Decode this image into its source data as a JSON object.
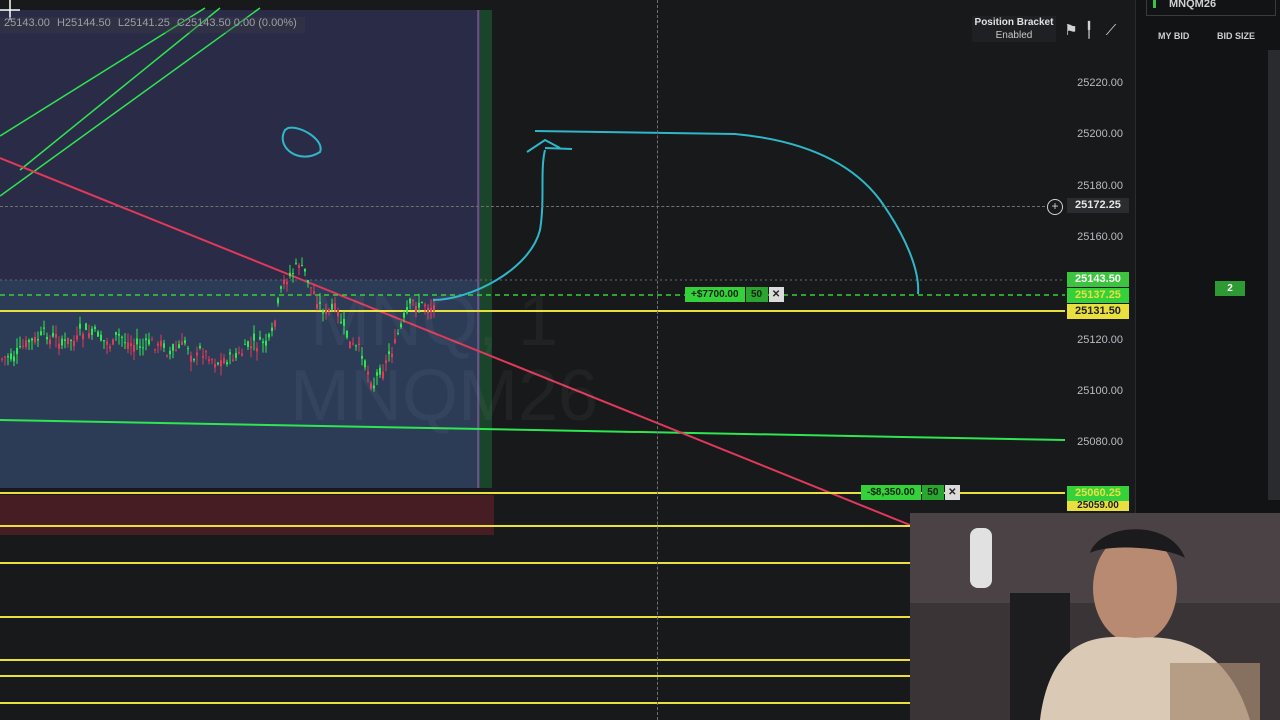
{
  "ohlc": {
    "open": "25143.00",
    "high": "H25144.50",
    "low": "L25141.25",
    "close": "C25143.50 0.00 (0.00%)"
  },
  "toolbar": {
    "position_bracket_label": "Position Bracket",
    "position_bracket_status": "Enabled",
    "icons": [
      "flag-icon",
      "pin-icon",
      "draw-line-icon"
    ]
  },
  "price_axis": {
    "labels": [
      "25220.00",
      "25200.00",
      "25180.00",
      "25160.00",
      "25120.00",
      "25100.00",
      "25080.00"
    ],
    "crosshair_price": "25172.25"
  },
  "price_tags": {
    "last_price": "25143.50",
    "entry_price": "25137.25",
    "level_price": "25131.50",
    "stop_price": "25060.25",
    "stop_price_2": "25059.00"
  },
  "orders": {
    "target": {
      "pnl": "+$7700.00",
      "qty": "50",
      "close": "✕"
    },
    "stop": {
      "pnl": "-$8,350.00",
      "qty": "50",
      "close": "✕"
    }
  },
  "watermark": {
    "line1": "MNQ, 1",
    "line2": "MNQM26"
  },
  "dom": {
    "symbol": "MNQM26",
    "col_my_bid": "MY BID",
    "col_bid_size": "BID SIZE",
    "bid_qty": "2"
  },
  "colors": {
    "accent_green": "#35d13a",
    "price_tag_bg": "#3cc43f",
    "level_yellow": "#e9e040",
    "trend_red": "#e0395a",
    "drawing_cyan": "#2fb7c9"
  }
}
